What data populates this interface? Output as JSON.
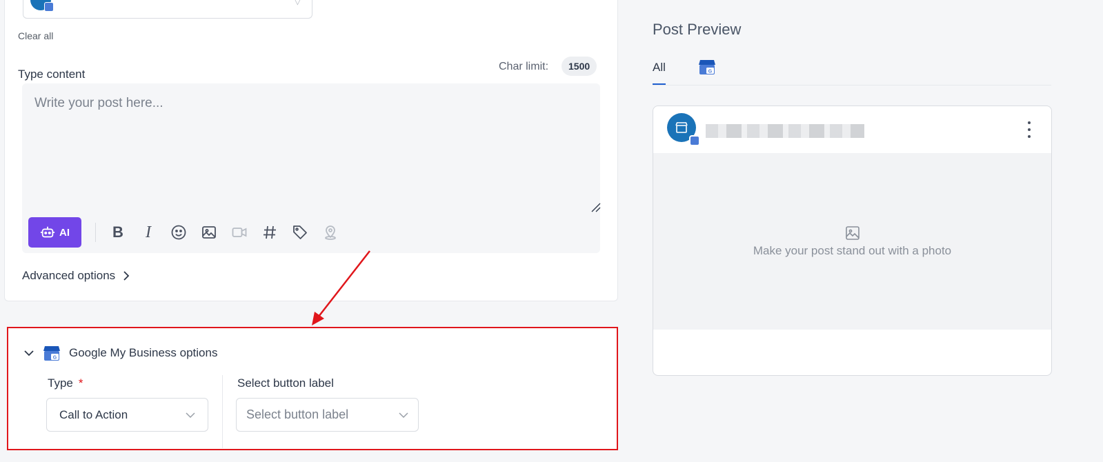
{
  "composer": {
    "clear_all": "Clear all",
    "type_content_label": "Type content",
    "char_limit_label": "Char limit:",
    "char_limit_value": "1500",
    "editor_placeholder": "Write your post here...",
    "ai_label": "AI",
    "advanced_options": "Advanced options"
  },
  "gmb_options": {
    "title": "Google My Business options",
    "type_label": "Type",
    "required_mark": "*",
    "type_value": "Call to Action",
    "button_label_title": "Select button label",
    "button_label_placeholder": "Select button label"
  },
  "preview": {
    "title": "Post Preview",
    "tab_all": "All",
    "photo_hint": "Make your post stand out with a photo"
  },
  "colors": {
    "ai_button": "#7246e8",
    "highlight_border": "#e0161b",
    "active_tab": "#1f5fcf",
    "avatar": "#1a73b8"
  },
  "icons": {
    "toolbar": [
      "bold-icon",
      "italic-icon",
      "emoji-icon",
      "image-icon",
      "video-icon",
      "hashtag-icon",
      "tag-icon",
      "location-icon"
    ]
  }
}
